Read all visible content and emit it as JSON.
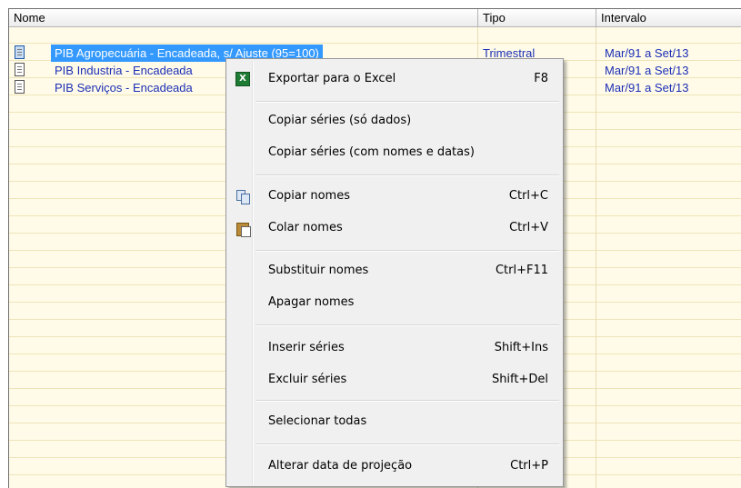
{
  "grid": {
    "columns": [
      {
        "label": "Nome"
      },
      {
        "label": "Tipo"
      },
      {
        "label": "Intervalo"
      }
    ],
    "rows": [
      {
        "name": "PIB Agropecuária - Encadeada, s/ Ajuste (95=100)",
        "tipo": "Trimestral",
        "intervalo": "Mar/91 a Set/13",
        "selected": true
      },
      {
        "name": "PIB Industria - Encadeada",
        "tipo": "",
        "intervalo": "Mar/91 a Set/13",
        "selected": false
      },
      {
        "name": "PIB Serviços - Encadeada",
        "tipo": "",
        "intervalo": "Mar/91 a Set/13",
        "selected": false
      }
    ]
  },
  "context_menu": {
    "items": [
      {
        "label": "Exportar para o Excel",
        "shortcut": "F8",
        "icon": "excel-icon"
      },
      {
        "label": "Copiar séries (só dados)",
        "shortcut": ""
      },
      {
        "label": "Copiar séries (com nomes e datas)",
        "shortcut": ""
      },
      {
        "label": "Copiar nomes",
        "shortcut": "Ctrl+C",
        "icon": "copy-icon"
      },
      {
        "label": "Colar nomes",
        "shortcut": "Ctrl+V",
        "icon": "paste-icon"
      },
      {
        "label": "Substituir nomes",
        "shortcut": "Ctrl+F11"
      },
      {
        "label": "Apagar nomes",
        "shortcut": ""
      },
      {
        "label": "Inserir séries",
        "shortcut": "Shift+Ins"
      },
      {
        "label": "Excluir séries",
        "shortcut": "Shift+Del"
      },
      {
        "label": "Selecionar todas",
        "shortcut": ""
      },
      {
        "label": "Alterar data de projeção",
        "shortcut": "Ctrl+P"
      }
    ]
  },
  "colors": {
    "selection": "#3399ff",
    "row_text": "#1c2fb5",
    "grid_background": "#fffbe8"
  }
}
